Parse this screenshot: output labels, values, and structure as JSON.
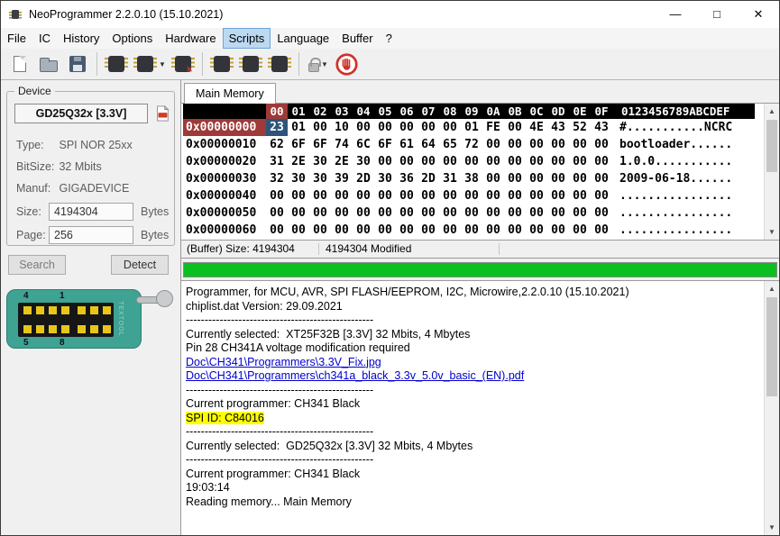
{
  "window": {
    "title": "NeoProgrammer 2.2.0.10 (15.10.2021)",
    "controls": {
      "minimize": "—",
      "maximize": "□",
      "close": "✕"
    }
  },
  "menu": {
    "items": [
      {
        "label": "File"
      },
      {
        "label": "IC"
      },
      {
        "label": "History"
      },
      {
        "label": "Options"
      },
      {
        "label": "Hardware"
      },
      {
        "label": "Scripts",
        "active": true
      },
      {
        "label": "Language"
      },
      {
        "label": "Buffer"
      },
      {
        "label": "?"
      }
    ]
  },
  "toolbar": {
    "buttons": [
      "new-file-icon",
      "open-folder-icon",
      "save-floppy-icon",
      "chip-read-icon",
      "chip-read-menu-icon",
      "chip-erase-icon",
      "chip-write-icon",
      "chip-verify-icon",
      "chip-blank-check-icon",
      "lock-icon",
      "stop-hand-icon"
    ]
  },
  "device": {
    "group_label": "Device",
    "selected": "GD25Q32x [3.3V]",
    "fields": [
      {
        "label": "Type:",
        "value": "SPI NOR  25xx"
      },
      {
        "label": "BitSize:",
        "value": "32 Mbits"
      },
      {
        "label": "Manuf:",
        "value": "GIGADEVICE"
      }
    ],
    "size": {
      "label": "Size:",
      "value": "4194304",
      "unit": "Bytes"
    },
    "page": {
      "label": "Page:",
      "value": "256",
      "unit": "Bytes"
    },
    "search_label": "Search",
    "detect_label": "Detect",
    "socket": {
      "pins_top": [
        "4",
        "1"
      ],
      "pins_bottom": [
        "5",
        "8"
      ],
      "brand": "TEXTOOL"
    }
  },
  "memory": {
    "tab": "Main Memory",
    "header_cols": [
      "00",
      "01",
      "02",
      "03",
      "04",
      "05",
      "06",
      "07",
      "08",
      "09",
      "0A",
      "0B",
      "0C",
      "0D",
      "0E",
      "0F"
    ],
    "ascii_header": "0123456789ABCDEF",
    "selected_cell": {
      "row": 0,
      "col": 0
    },
    "rows": [
      {
        "addr": "0x00000000",
        "bytes": [
          "23",
          "01",
          "00",
          "10",
          "00",
          "00",
          "00",
          "00",
          "00",
          "01",
          "FE",
          "00",
          "4E",
          "43",
          "52",
          "43"
        ],
        "ascii": "#...........NCRC"
      },
      {
        "addr": "0x00000010",
        "bytes": [
          "62",
          "6F",
          "6F",
          "74",
          "6C",
          "6F",
          "61",
          "64",
          "65",
          "72",
          "00",
          "00",
          "00",
          "00",
          "00",
          "00"
        ],
        "ascii": "bootloader......"
      },
      {
        "addr": "0x00000020",
        "bytes": [
          "31",
          "2E",
          "30",
          "2E",
          "30",
          "00",
          "00",
          "00",
          "00",
          "00",
          "00",
          "00",
          "00",
          "00",
          "00",
          "00"
        ],
        "ascii": "1.0.0..........."
      },
      {
        "addr": "0x00000030",
        "bytes": [
          "32",
          "30",
          "30",
          "39",
          "2D",
          "30",
          "36",
          "2D",
          "31",
          "38",
          "00",
          "00",
          "00",
          "00",
          "00",
          "00"
        ],
        "ascii": "2009-06-18......"
      },
      {
        "addr": "0x00000040",
        "bytes": [
          "00",
          "00",
          "00",
          "00",
          "00",
          "00",
          "00",
          "00",
          "00",
          "00",
          "00",
          "00",
          "00",
          "00",
          "00",
          "00"
        ],
        "ascii": "................"
      },
      {
        "addr": "0x00000050",
        "bytes": [
          "00",
          "00",
          "00",
          "00",
          "00",
          "00",
          "00",
          "00",
          "00",
          "00",
          "00",
          "00",
          "00",
          "00",
          "00",
          "00"
        ],
        "ascii": "................"
      },
      {
        "addr": "0x00000060",
        "bytes": [
          "00",
          "00",
          "00",
          "00",
          "00",
          "00",
          "00",
          "00",
          "00",
          "00",
          "00",
          "00",
          "00",
          "00",
          "00",
          "00"
        ],
        "ascii": "................"
      }
    ]
  },
  "status": {
    "left": "(Buffer) Size: 4194304",
    "right": "4194304 Modified"
  },
  "progress": {
    "value": 100,
    "color": "#0bbf20"
  },
  "log": {
    "lines": [
      {
        "type": "text",
        "text": "Programmer, for MCU, AVR, SPI FLASH/EEPROM, I2C, Microwire,2.2.0.10 (15.10.2021)"
      },
      {
        "type": "text",
        "text": "chiplist.dat Version: 29.09.2021"
      },
      {
        "type": "separator",
        "text": "--------------------------------------------------"
      },
      {
        "type": "text",
        "text": "Currently selected:  XT25F32B [3.3V] 32 Mbits, 4 Mbytes"
      },
      {
        "type": "text",
        "text": "Pin 28 CH341A voltage modification required"
      },
      {
        "type": "link",
        "text": "Doc\\CH341\\Programmers\\3.3V_Fix.jpg"
      },
      {
        "type": "link",
        "text": "Doc\\CH341\\Programmers\\ch341a_black_3.3v_5.0v_basic_(EN).pdf"
      },
      {
        "type": "separator",
        "text": "--------------------------------------------------"
      },
      {
        "type": "text",
        "text": "Current programmer: CH341 Black"
      },
      {
        "type": "highlight",
        "text": "SPI ID: C84016"
      },
      {
        "type": "separator",
        "text": "--------------------------------------------------"
      },
      {
        "type": "text",
        "text": "Currently selected:  GD25Q32x [3.3V] 32 Mbits, 4 Mbytes"
      },
      {
        "type": "separator",
        "text": "--------------------------------------------------"
      },
      {
        "type": "text",
        "text": "Current programmer: CH341 Black"
      },
      {
        "type": "text",
        "text": "19:03:14"
      },
      {
        "type": "text",
        "text": "Reading memory... Main Memory"
      }
    ]
  },
  "colors": {
    "progress_green": "#0bbf20",
    "spi_highlight_yellow": "#ffff00",
    "link_blue": "#0000cc",
    "selected_marker_red": "#9e3a38",
    "selected_byte_blue": "#2d5579",
    "hex_header_bg": "#000000",
    "menu_highlight": "#bcd9f2"
  }
}
